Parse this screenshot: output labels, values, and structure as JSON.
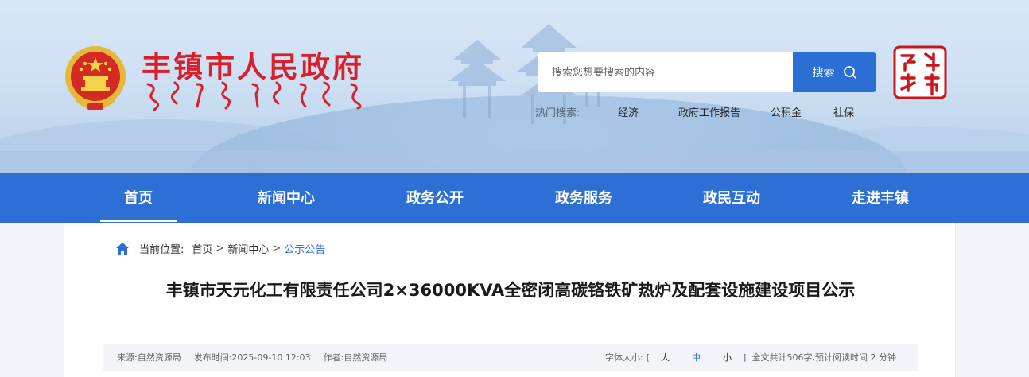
{
  "header": {
    "site_title": "丰镇市人民政府",
    "mongolian_subtitle": "ᠹᠧᠩᠵᠧᠨ ᠬᠣᠲᠠ ᠶᠢᠨ ᠠᠷᠠᠳ ᠤᠨ ᠵᠠᠰᠠᠭ ᠤᠨ ᠭᠠᠵᠠᠷ",
    "emblem": "national-emblem",
    "seal_icon": "red-seal-logo"
  },
  "search": {
    "placeholder": "搜索您想要搜索的内容",
    "button_label": "搜索",
    "hot_label": "热门搜索:",
    "hot_items": [
      "经济",
      "政府工作报告",
      "公积金",
      "社保"
    ]
  },
  "nav": {
    "items": [
      {
        "label": "首页",
        "active": true
      },
      {
        "label": "新闻中心",
        "active": false
      },
      {
        "label": "政务公开",
        "active": false
      },
      {
        "label": "政务服务",
        "active": false
      },
      {
        "label": "政民互动",
        "active": false
      },
      {
        "label": "走进丰镇",
        "active": false
      }
    ]
  },
  "breadcrumb": {
    "prefix": "当前位置:",
    "items": [
      "首页",
      "新闻中心",
      "公示公告"
    ],
    "separator": ">"
  },
  "article": {
    "title": "丰镇市天元化工有限责任公司2×36000KVA全密闭高碳铬铁矿热炉及配套设施建设项目公示",
    "source": "来源:自然资源局",
    "published": "发布时间:2025-09-10 12:03",
    "author": "作者:自然资源局",
    "font_size_label": "字体大小:",
    "font_size_open": "[",
    "font_sizes": [
      "大",
      "中",
      "小"
    ],
    "font_size_close": "]",
    "word_count": "全文共计506字,预计阅读时间 2 分钟"
  },
  "colors": {
    "brand_red": "#d7202a",
    "nav_blue": "#2e6fd6",
    "search_blue": "#2b6fd4"
  }
}
